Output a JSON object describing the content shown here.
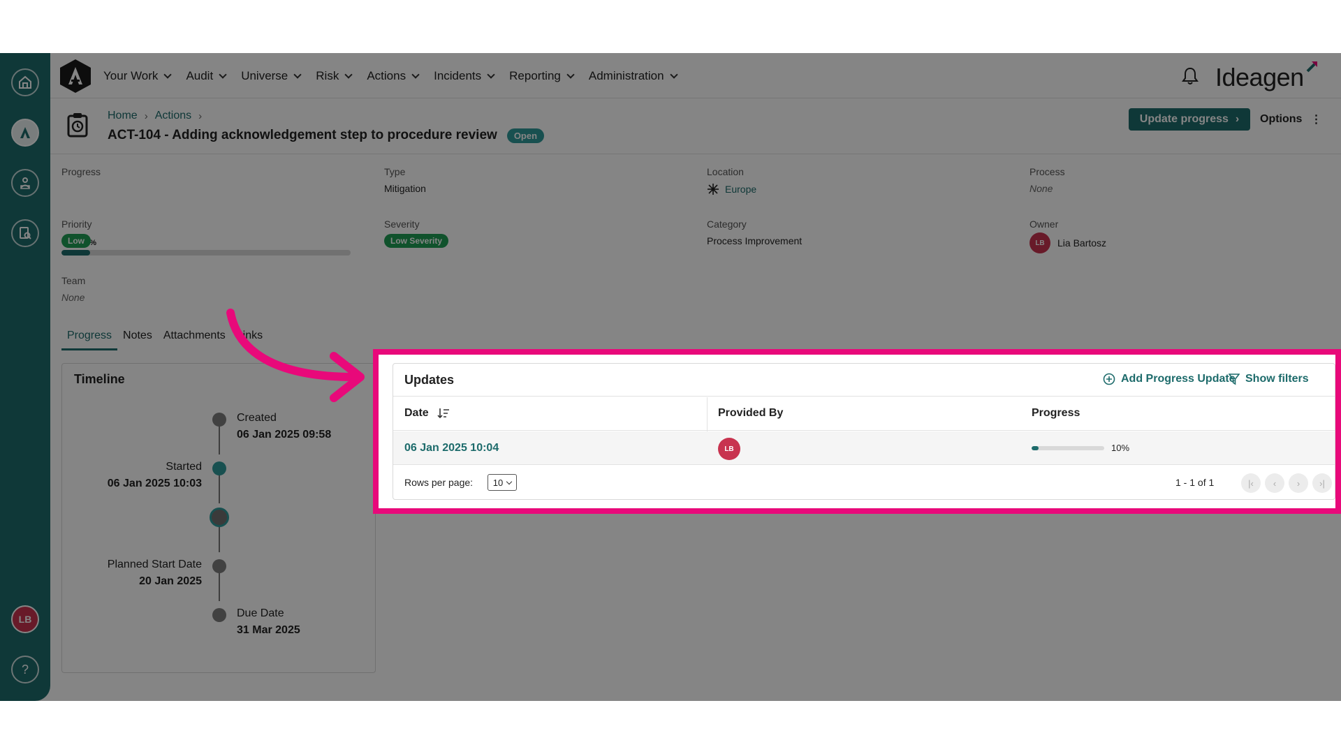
{
  "nav": {
    "items": [
      {
        "label": "Your Work"
      },
      {
        "label": "Audit"
      },
      {
        "label": "Universe"
      },
      {
        "label": "Risk"
      },
      {
        "label": "Actions"
      },
      {
        "label": "Incidents"
      },
      {
        "label": "Reporting"
      },
      {
        "label": "Administration"
      }
    ],
    "brand": "Ideagen"
  },
  "sidebar": {
    "icons": [
      "home-icon",
      "ideagen-logo-icon",
      "people-icon",
      "document-search-icon"
    ],
    "avatar_initials": "LB",
    "help_label": "?"
  },
  "header": {
    "breadcrumb": [
      "Home",
      "Actions"
    ],
    "title": "ACT-104 - Adding acknowledgement step to procedure review",
    "status": "Open",
    "update_button": "Update progress",
    "options_button": "Options"
  },
  "details": {
    "progress": {
      "label": "Progress",
      "value_text": "10%",
      "value": 0.1
    },
    "type": {
      "label": "Type",
      "value": "Mitigation"
    },
    "location": {
      "label": "Location",
      "value": "Europe"
    },
    "process": {
      "label": "Process",
      "value": "None"
    },
    "priority": {
      "label": "Priority",
      "value": "Low"
    },
    "severity": {
      "label": "Severity",
      "value": "Low Severity"
    },
    "category": {
      "label": "Category",
      "value": "Process Improvement"
    },
    "owner": {
      "label": "Owner",
      "initials": "LB",
      "value": "Lia Bartosz"
    },
    "team": {
      "label": "Team",
      "value": "None"
    }
  },
  "tabs": [
    {
      "label": "Progress",
      "active": true
    },
    {
      "label": "Notes",
      "active": false
    },
    {
      "label": "Attachments",
      "active": false
    },
    {
      "label": "Links",
      "active": false
    }
  ],
  "timeline": {
    "title": "Timeline",
    "events": [
      {
        "label": "Created",
        "date": "06 Jan 2025 09:58"
      },
      {
        "label": "Started",
        "date": "06 Jan 2025 10:03"
      },
      {
        "label": "Planned Start Date",
        "date": "20 Jan 2025"
      },
      {
        "label": "Due Date",
        "date": "31 Mar 2025"
      }
    ]
  },
  "updates": {
    "title": "Updates",
    "add_button": "Add Progress Update",
    "filter_button": "Show filters",
    "columns": [
      "Date",
      "Provided By",
      "Progress"
    ],
    "rows": [
      {
        "date": "06 Jan 2025 10:04",
        "provided_by_initials": "LB",
        "progress_text": "10%",
        "progress": 0.1
      }
    ],
    "rows_per_page_label": "Rows per page:",
    "rows_per_page": "10",
    "page_info": "1 - 1 of 1"
  },
  "colors": {
    "primary": "#1d6b6b",
    "highlight": "#e8097a",
    "avatar": "#c8334f",
    "low_pill": "#1f9d55"
  }
}
